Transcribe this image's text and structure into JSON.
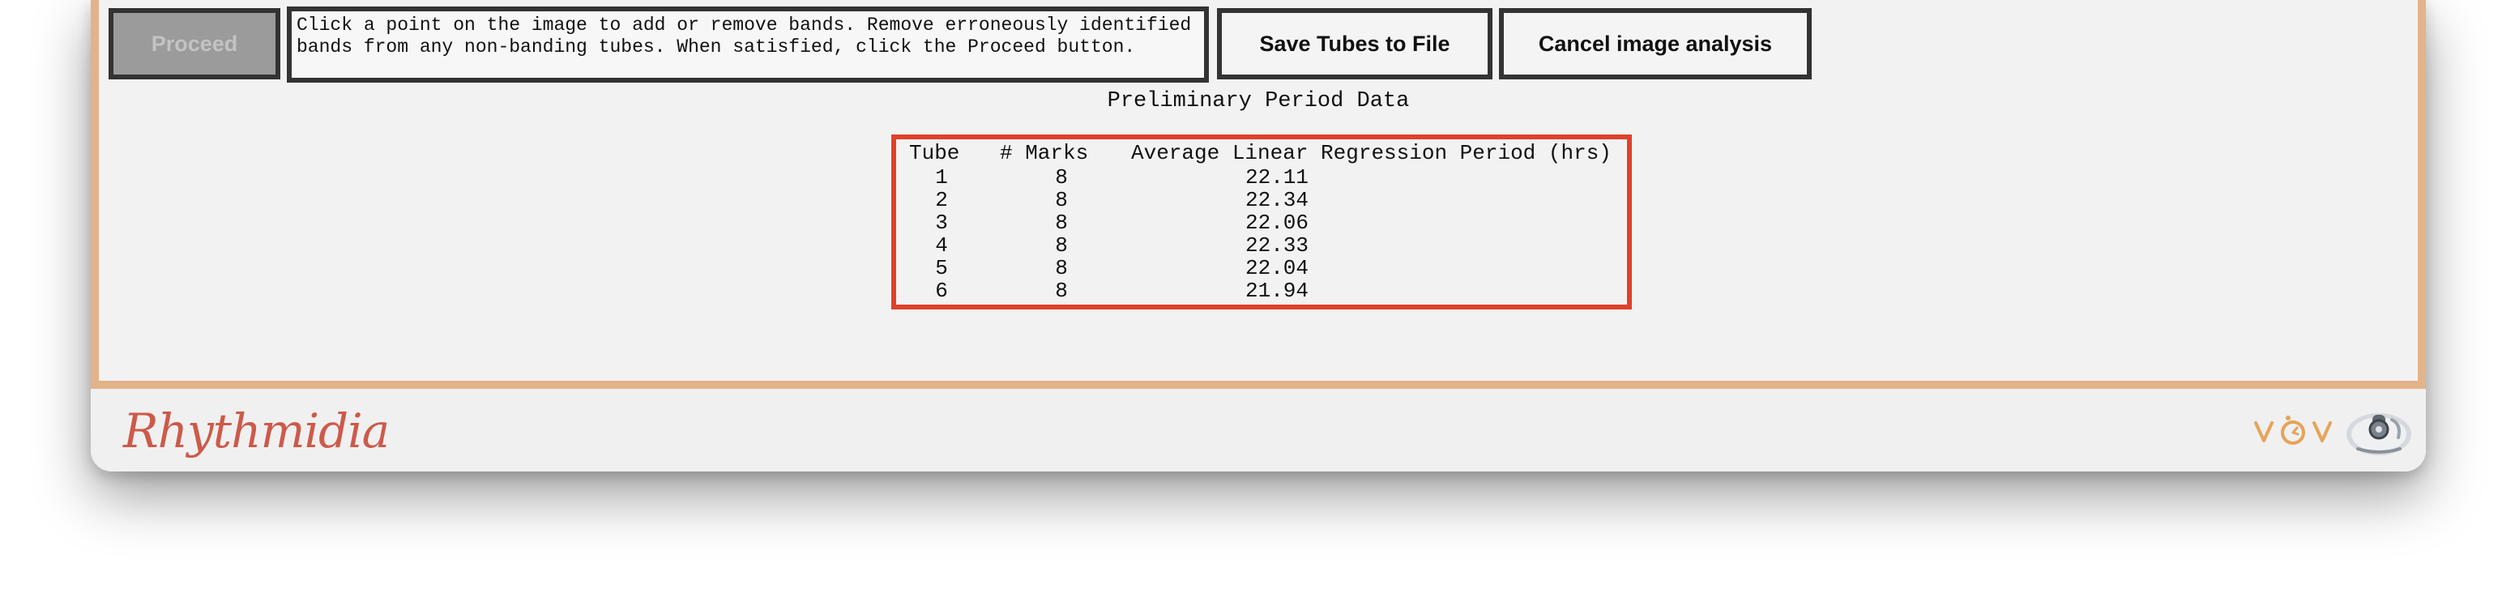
{
  "toolbar": {
    "proceed_label": "Proceed",
    "save_label": "Save Tubes to File",
    "cancel_label": "Cancel image analysis"
  },
  "instructions": {
    "line1": "Click a point on the image to add or remove bands. Remove erroneously identified",
    "line2": "bands from any non-banding tubes. When satisfied, click the Proceed button."
  },
  "results": {
    "title": "Preliminary Period Data",
    "headers": {
      "tube": "Tube",
      "marks": "# Marks",
      "period": "Average Linear Regression Period (hrs)"
    },
    "rows": [
      {
        "tube": "1",
        "marks": "8",
        "period": "22.11"
      },
      {
        "tube": "2",
        "marks": "8",
        "period": "22.34"
      },
      {
        "tube": "3",
        "marks": "8",
        "period": "22.06"
      },
      {
        "tube": "4",
        "marks": "8",
        "period": "22.33"
      },
      {
        "tube": "5",
        "marks": "8",
        "period": "22.04"
      },
      {
        "tube": "6",
        "marks": "8",
        "period": "21.94"
      }
    ]
  },
  "footer": {
    "brand": "Rhythmidia",
    "icons": [
      "vov-logo-icon",
      "microscope-icon"
    ]
  },
  "colors": {
    "frame": "#e3b38a",
    "highlight": "#e0412a",
    "brand": "#cd5a4a"
  }
}
